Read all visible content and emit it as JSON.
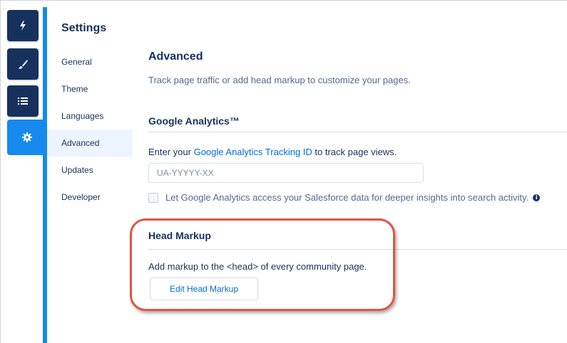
{
  "rail": {
    "buttons": [
      {
        "name": "bolt-icon",
        "active": false
      },
      {
        "name": "brush-icon",
        "active": false
      },
      {
        "name": "list-icon",
        "active": false
      },
      {
        "name": "gear-icon",
        "active": true
      }
    ],
    "colors": {
      "dark": "#16325c",
      "active": "#1589ee"
    }
  },
  "settings": {
    "title": "Settings",
    "nav": [
      "General",
      "Theme",
      "Languages",
      "Advanced",
      "Updates",
      "Developer"
    ],
    "active": "Advanced"
  },
  "main": {
    "title": "Advanced",
    "subtitle": "Track page traffic or add head markup to customize your pages.",
    "ga": {
      "heading": "Google Analytics™",
      "line_prefix": "Enter your ",
      "link": "Google Analytics Tracking ID",
      "line_suffix": " to track page views.",
      "placeholder": "UA-YYYYY-XX",
      "checkbox_label": "Let Google Analytics access your Salesforce data for deeper insights into search activity.",
      "checkbox_checked": false,
      "info_icon": "info-icon"
    },
    "head": {
      "heading": "Head Markup",
      "description": "Add markup to the <head> of every community page.",
      "button": "Edit Head Markup"
    }
  },
  "highlight_color": "#e5533f"
}
